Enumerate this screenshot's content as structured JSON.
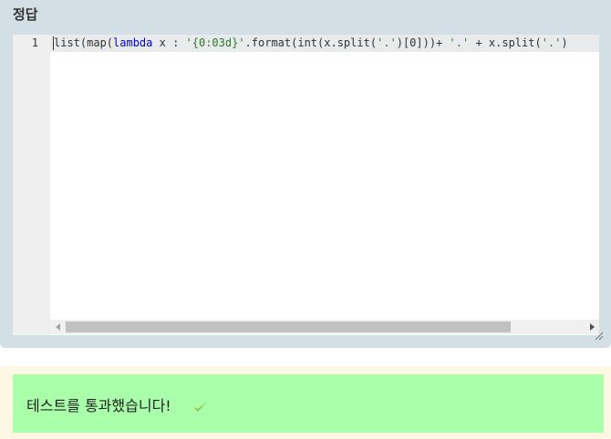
{
  "answer": {
    "title": "정답"
  },
  "editor": {
    "line_number": "1",
    "code_tokens": [
      {
        "text": "list(map(",
        "kind": "plain"
      },
      {
        "text": "lambda",
        "kind": "kw"
      },
      {
        "text": " x : ",
        "kind": "plain"
      },
      {
        "text": "'{0:03d}'",
        "kind": "str"
      },
      {
        "text": ".format(int(x.split(",
        "kind": "plain"
      },
      {
        "text": "'.'",
        "kind": "str"
      },
      {
        "text": ")[0]))+ ",
        "kind": "plain"
      },
      {
        "text": "'.'",
        "kind": "str"
      },
      {
        "text": " + x.split(",
        "kind": "plain"
      },
      {
        "text": "'.'",
        "kind": "str"
      },
      {
        "text": ")",
        "kind": "plain"
      }
    ]
  },
  "result": {
    "message": "테스트를 통과했습니다!",
    "icon": "check-icon",
    "check_color": "#8bc34a",
    "box_color": "#aaffaa"
  }
}
